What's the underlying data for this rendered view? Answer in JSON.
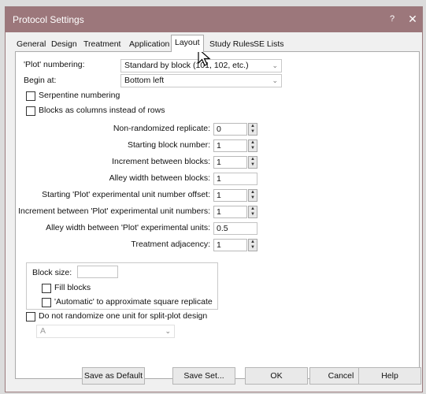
{
  "window": {
    "title": "Protocol Settings",
    "help_btn": "?",
    "close_btn": "✕"
  },
  "tabs": [
    "General",
    "Design",
    "Treatment",
    "Application",
    "Layout",
    "Study Rules",
    "SE Lists"
  ],
  "active_tab": "Layout",
  "form": {
    "plot_numbering_label": "'Plot' numbering:",
    "plot_numbering_value": "Standard by block (101, 102, etc.)",
    "begin_at_label": "Begin at:",
    "begin_at_value": "Bottom left",
    "serpentine_label": "Serpentine numbering",
    "blocks_columns_label": "Blocks as columns instead of rows",
    "nonrandomized_label": "Non-randomized replicate:",
    "nonrandomized_value": "0",
    "starting_block_label": "Starting block number:",
    "starting_block_value": "1",
    "increment_blocks_label": "Increment between blocks:",
    "increment_blocks_value": "1",
    "alley_blocks_label": "Alley width between blocks:",
    "alley_blocks_value": "1",
    "starting_plot_label": "Starting 'Plot' experimental unit number offset:",
    "starting_plot_value": "1",
    "increment_plot_label": "Increment between 'Plot' experimental unit numbers:",
    "increment_plot_value": "1",
    "alley_plot_label": "Alley width between 'Plot' experimental units:",
    "alley_plot_value": "0.5",
    "treatment_adjacency_label": "Treatment adjacency:",
    "treatment_adjacency_value": "1",
    "block_size_label": "Block size:",
    "block_size_value": "",
    "fill_blocks_label": "Fill blocks",
    "automatic_label": "'Automatic' to approximate square replicate",
    "do_not_randomize_label": "Do not randomize one unit for split-plot design",
    "split_select_value": "A"
  },
  "footer": {
    "save_default": "Save as Default",
    "save_set": "Save Set...",
    "ok": "OK",
    "cancel": "Cancel",
    "help": "Help"
  }
}
